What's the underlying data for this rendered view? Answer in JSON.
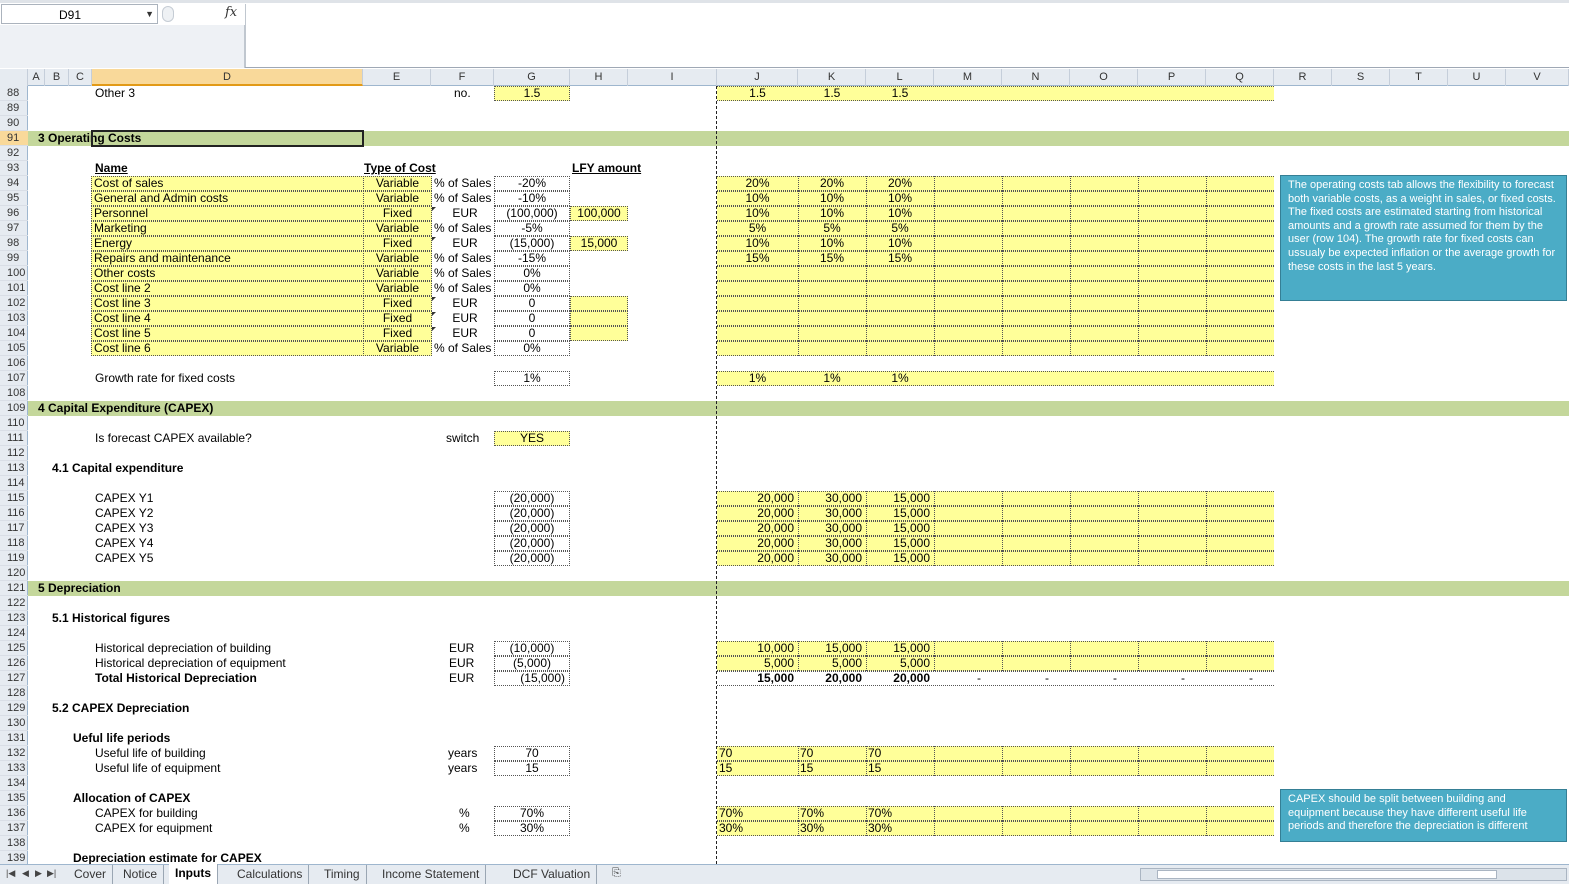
{
  "formula_bar": {
    "name_box": "D91",
    "fx_label": "fx",
    "formula": ""
  },
  "columns": [
    {
      "label": "A"
    },
    {
      "label": "B"
    },
    {
      "label": "C"
    },
    {
      "label": "D"
    },
    {
      "label": "E"
    },
    {
      "label": "F"
    },
    {
      "label": "G"
    },
    {
      "label": "H"
    },
    {
      "label": "I"
    },
    {
      "label": "J"
    },
    {
      "label": "K"
    },
    {
      "label": "L"
    },
    {
      "label": "M"
    },
    {
      "label": "N"
    },
    {
      "label": "O"
    },
    {
      "label": "P"
    },
    {
      "label": "Q"
    },
    {
      "label": "R"
    },
    {
      "label": "S"
    },
    {
      "label": "T"
    },
    {
      "label": "U"
    },
    {
      "label": "V"
    }
  ],
  "rows": [
    "88",
    "89",
    "90",
    "91",
    "92",
    "93",
    "94",
    "95",
    "96",
    "97",
    "98",
    "99",
    "100",
    "101",
    "102",
    "103",
    "104",
    "105",
    "106",
    "107",
    "108",
    "109",
    "110",
    "111",
    "112",
    "113",
    "114",
    "115",
    "116",
    "117",
    "118",
    "119",
    "120",
    "121",
    "122",
    "123",
    "124",
    "125",
    "126",
    "127",
    "128",
    "129",
    "130",
    "131",
    "132",
    "133",
    "134",
    "135",
    "136",
    "137",
    "138",
    "139"
  ],
  "sheet": {
    "r88": {
      "label": "Other 3",
      "unit": "no.",
      "g": "1.5",
      "j": "1.5",
      "k": "1.5",
      "l": "1.5"
    },
    "sec3": {
      "title": "3  Operating Costs"
    },
    "hdr93": {
      "name": "Name",
      "type": "Type of Cost",
      "lfy": "LFY amount"
    },
    "costs": [
      {
        "name": "Cost of sales",
        "type": "Variable",
        "unit": "% of Sales",
        "g": "-20%",
        "h": "",
        "j": "20%",
        "k": "20%",
        "l": "20%"
      },
      {
        "name": "General and Admin costs",
        "type": "Variable",
        "unit": "% of Sales",
        "g": "-10%",
        "h": "",
        "j": "10%",
        "k": "10%",
        "l": "10%"
      },
      {
        "name": "Personnel",
        "type": "Fixed",
        "unit": "EUR",
        "g": "(100,000)",
        "h": "100,000",
        "j": "10%",
        "k": "10%",
        "l": "10%"
      },
      {
        "name": "Marketing",
        "type": "Variable",
        "unit": "% of Sales",
        "g": "-5%",
        "h": "",
        "j": "5%",
        "k": "5%",
        "l": "5%"
      },
      {
        "name": "Energy",
        "type": "Fixed",
        "unit": "EUR",
        "g": "(15,000)",
        "h": "15,000",
        "j": "10%",
        "k": "10%",
        "l": "10%"
      },
      {
        "name": "Repairs and maintenance",
        "type": "Variable",
        "unit": "% of Sales",
        "g": "-15%",
        "h": "",
        "j": "15%",
        "k": "15%",
        "l": "15%"
      },
      {
        "name": "Other costs",
        "type": "Variable",
        "unit": "% of Sales",
        "g": "0%",
        "h": "",
        "j": "",
        "k": "",
        "l": ""
      },
      {
        "name": "Cost line 2",
        "type": "Variable",
        "unit": "% of Sales",
        "g": "0%",
        "h": "",
        "j": "",
        "k": "",
        "l": ""
      },
      {
        "name": "Cost line 3",
        "type": "Fixed",
        "unit": "EUR",
        "g": "0",
        "h": "",
        "j": "",
        "k": "",
        "l": ""
      },
      {
        "name": "Cost line 4",
        "type": "Fixed",
        "unit": "EUR",
        "g": "0",
        "h": "",
        "j": "",
        "k": "",
        "l": ""
      },
      {
        "name": "Cost line 5",
        "type": "Fixed",
        "unit": "EUR",
        "g": "0",
        "h": "",
        "j": "",
        "k": "",
        "l": ""
      },
      {
        "name": "Cost line 6",
        "type": "Variable",
        "unit": "% of Sales",
        "g": "0%",
        "h": "",
        "j": "",
        "k": "",
        "l": ""
      }
    ],
    "growth": {
      "label": "Growth rate for fixed costs",
      "g": "1%",
      "j": "1%",
      "k": "1%",
      "l": "1%"
    },
    "sec4": {
      "title": "4  Capital Expenditure (CAPEX)"
    },
    "capex_switch": {
      "label": "Is forecast CAPEX available?",
      "unit": "switch",
      "g": "YES"
    },
    "sub41": {
      "title": "4.1  Capital expenditure"
    },
    "capex": [
      {
        "label": "CAPEX Y1",
        "g": "(20,000)",
        "j": "20,000",
        "k": "30,000",
        "l": "15,000"
      },
      {
        "label": "CAPEX Y2",
        "g": "(20,000)",
        "j": "20,000",
        "k": "30,000",
        "l": "15,000"
      },
      {
        "label": "CAPEX Y3",
        "g": "(20,000)",
        "j": "20,000",
        "k": "30,000",
        "l": "15,000"
      },
      {
        "label": "CAPEX Y4",
        "g": "(20,000)",
        "j": "20,000",
        "k": "30,000",
        "l": "15,000"
      },
      {
        "label": "CAPEX Y5",
        "g": "(20,000)",
        "j": "20,000",
        "k": "30,000",
        "l": "15,000"
      }
    ],
    "sec5": {
      "title": "5  Depreciation"
    },
    "sub51": {
      "title": "5.1  Historical figures"
    },
    "hist": [
      {
        "label": "Historical depreciation of building",
        "unit": "EUR",
        "g": "(10,000)",
        "j": "10,000",
        "k": "15,000",
        "l": "15,000"
      },
      {
        "label": "Historical depreciation of equipment",
        "unit": "EUR",
        "g": "(5,000)",
        "j": "5,000",
        "k": "5,000",
        "l": "5,000"
      }
    ],
    "hist_total": {
      "label": "Total Historical Depreciation",
      "unit": "EUR",
      "g": "(15,000)",
      "j": "15,000",
      "k": "20,000",
      "l": "20,000",
      "m": "-",
      "n": "-",
      "o": "-",
      "p": "-",
      "q": "-"
    },
    "sub52": {
      "title": "5.2  CAPEX Depreciation"
    },
    "useful_hdr": {
      "title": "Ueful life periods"
    },
    "useful": [
      {
        "label": "Useful life of building",
        "unit": "years",
        "g": "70",
        "j": "70",
        "k": "70",
        "l": "70"
      },
      {
        "label": "Useful life of equipment",
        "unit": "years",
        "g": "15",
        "j": "15",
        "k": "15",
        "l": "15"
      }
    ],
    "alloc_hdr": {
      "title": "Allocation of CAPEX"
    },
    "alloc": [
      {
        "label": "CAPEX for building",
        "unit": "%",
        "g": "70%",
        "j": "70%",
        "k": "70%",
        "l": "70%"
      },
      {
        "label": "CAPEX for equipment",
        "unit": "%",
        "g": "30%",
        "j": "30%",
        "k": "30%",
        "l": "30%"
      }
    ],
    "dep_hdr": {
      "title": "Depreciation estimate for CAPEX"
    }
  },
  "notes": {
    "opcosts": "The operating costs tab allows the flexibility to forecast both variable costs, as a weight in sales, or fixed costs. The fixed costs are estimated starting from historical amounts and a growth rate assumed for them by the user (row 104). The growth rate for fixed costs can ussualy be expected inflation or the average growth for these costs in the last 5 years.",
    "capex": "CAPEX  should be split between building and equipment  because they have different useful life periods and therefore the depreciation is different"
  },
  "tabs": [
    {
      "label": "Cover"
    },
    {
      "label": "Notice"
    },
    {
      "label": "Inputs",
      "active": true
    },
    {
      "label": "Calculations"
    },
    {
      "label": "Timing"
    },
    {
      "label": "Income Statement"
    },
    {
      "label": "DCF Valuation"
    }
  ],
  "colors": {
    "band": "#c4d79b",
    "input": "#ffff99",
    "note": "#4bacc6",
    "header": "#e6ebf1",
    "selected_header": "#f9d99a"
  }
}
